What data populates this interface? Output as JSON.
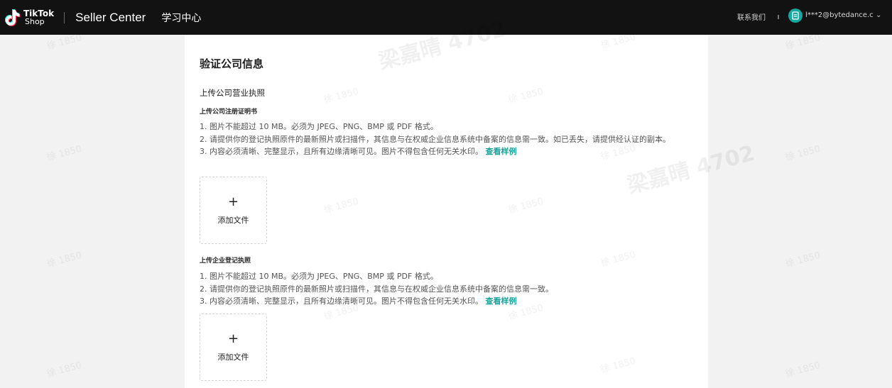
{
  "header": {
    "logo_line1": "TikTok",
    "logo_line2": "Shop",
    "app_name": "Seller Center",
    "learning_center": "学习中心",
    "contact": "联系我们",
    "account_email": "l***2@bytedance.c",
    "colors": {
      "topbar": "#121212",
      "avatar": "#16a89e"
    }
  },
  "page": {
    "title": "验证公司信息",
    "section_title": "上传公司营业执照",
    "block1": {
      "subtitle": "上传公司注册证明书",
      "rule1": "1. 图片不能超过 10 MB。必须为 JPEG、PNG、BMP 或 PDF 格式。",
      "rule2": "2. 请提供你的登记执照原件的最新照片或扫描件，其信息与在权威企业信息系统中备案的信息需一致。如已丢失，请提供经认证的副本。",
      "rule3": "3. 内容必须清晰、完整显示，且所有边缘清晰可见。图片不得包含任何无关水印。",
      "example_link": "查看样例",
      "upload_label": "添加文件"
    },
    "block2": {
      "subtitle": "上传企业登记执照",
      "rule1": "1. 图片不能超过 10 MB。必须为 JPEG、PNG、BMP 或 PDF 格式。",
      "rule2": "2. 请提供你的登记执照原件的最新照片或扫描件，其信息与在权威企业信息系统中备案的信息需一致。",
      "rule3": "3. 内容必须清晰、完整显示，且所有边缘清晰可见。图片不得包含任何无关水印。",
      "example_link": "查看样例",
      "upload_label": "添加文件"
    },
    "link_color": "#1aa39a"
  },
  "watermarks": {
    "small": "徐 1850",
    "large": "梁嘉晴 4702"
  }
}
